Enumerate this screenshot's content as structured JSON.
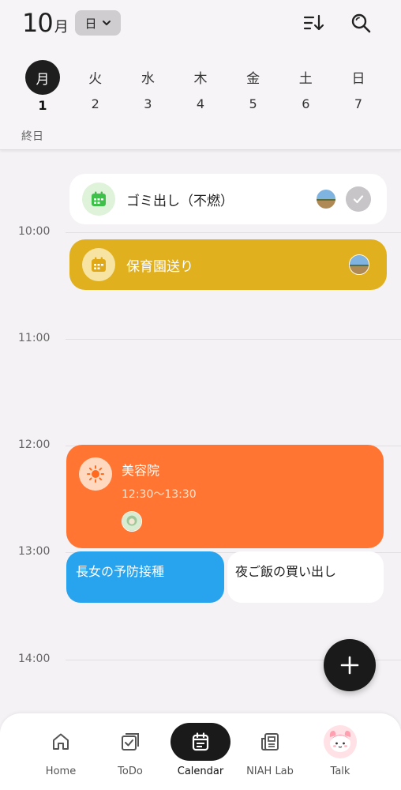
{
  "header": {
    "month_number": "10",
    "month_suffix": "月",
    "view_mode": "日",
    "icons": [
      "sort-icon",
      "search-icon"
    ]
  },
  "week": {
    "days": [
      {
        "dow": "月",
        "date": "1",
        "selected": true
      },
      {
        "dow": "火",
        "date": "2"
      },
      {
        "dow": "水",
        "date": "3"
      },
      {
        "dow": "木",
        "date": "4"
      },
      {
        "dow": "金",
        "date": "5"
      },
      {
        "dow": "土",
        "date": "6"
      },
      {
        "dow": "日",
        "date": "7"
      }
    ],
    "all_day_label": "終日"
  },
  "timeline": {
    "hours": [
      "10:00",
      "11:00",
      "12:00",
      "13:00",
      "14:00"
    ]
  },
  "events": {
    "gomi": {
      "title": "ゴミ出し（不燃）",
      "color": "#ffffff",
      "icon": "calendar-icon",
      "completed": true
    },
    "hoiku": {
      "title": "保育園送り",
      "color": "#e0b01e",
      "icon": "calendar-icon"
    },
    "biyo": {
      "title": "美容院",
      "time": "12:30～13:30",
      "color": "#ff7531",
      "icon": "sun-icon"
    },
    "vacc": {
      "title": "長女の予防接種",
      "color": "#28a3ee"
    },
    "dinner": {
      "title": "夜ご飯の買い出し",
      "color": "#ffffff"
    }
  },
  "fab": {
    "icon": "plus-icon"
  },
  "nav": {
    "items": [
      {
        "label": "Home",
        "icon": "home-icon"
      },
      {
        "label": "ToDo",
        "icon": "todo-icon"
      },
      {
        "label": "Calendar",
        "icon": "calendar-icon",
        "active": true
      },
      {
        "label": "NIAH Lab",
        "icon": "news-icon"
      },
      {
        "label": "Talk",
        "icon": "mascot-icon"
      }
    ]
  }
}
